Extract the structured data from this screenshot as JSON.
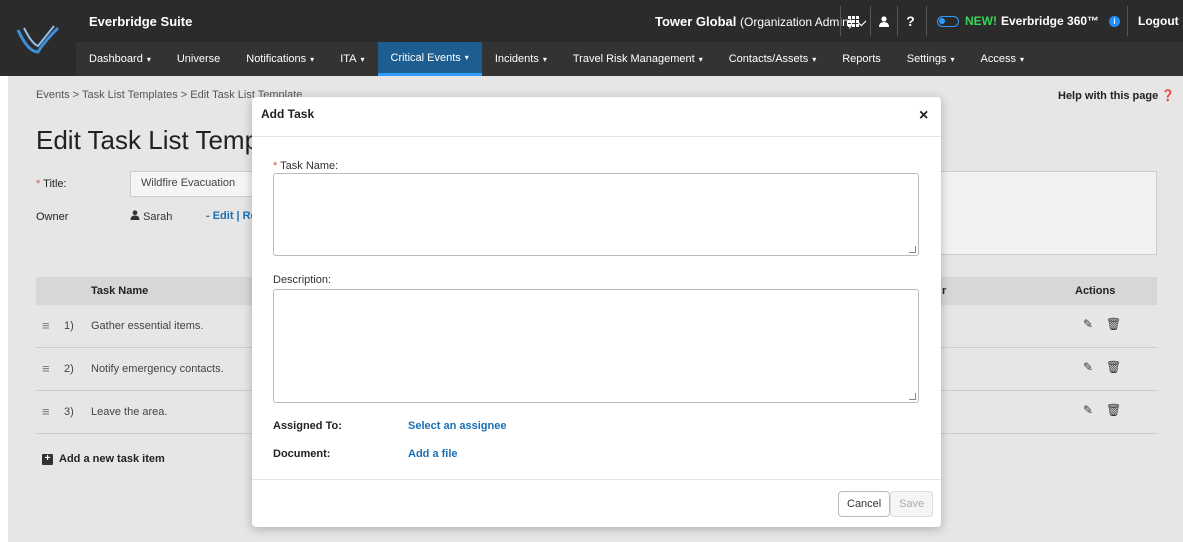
{
  "header": {
    "suite_title": "Everbridge Suite",
    "org_name": "Tower Global",
    "org_role": "(Organization Admin)",
    "new_label": "NEW!",
    "e360_label": "Everbridge 360™",
    "help_icon_text": "?",
    "logout": "Logout"
  },
  "nav": {
    "items": [
      {
        "label": "Dashboard",
        "chev": "▾"
      },
      {
        "label": "Universe",
        "chev": ""
      },
      {
        "label": "Notifications",
        "chev": "▾"
      },
      {
        "label": "ITA",
        "chev": "▾"
      },
      {
        "label": "Critical Events",
        "chev": "▾",
        "active": true
      },
      {
        "label": "Incidents",
        "chev": "▾"
      },
      {
        "label": "Travel Risk Management",
        "chev": "▾"
      },
      {
        "label": "Contacts/Assets",
        "chev": "▾"
      },
      {
        "label": "Reports",
        "chev": ""
      },
      {
        "label": "Settings",
        "chev": "▾"
      },
      {
        "label": "Access",
        "chev": "▾"
      }
    ]
  },
  "breadcrumb": "Events  >  Task List Templates  >  Edit Task List Template",
  "help_page": "Help with this page",
  "page_title": "Edit Task List Temp",
  "form": {
    "title_label": "Title:",
    "title_value": "Wildfire Evacuation",
    "owner_label": "Owner",
    "owner_value": "Sarah",
    "owner_links": "- Edit  |  Re"
  },
  "table": {
    "col_task_name": "Task Name",
    "col_partial": "r",
    "col_actions": "Actions",
    "rows": [
      {
        "num": "1)",
        "name": "Gather essential items."
      },
      {
        "num": "2)",
        "name": "Notify emergency contacts."
      },
      {
        "num": "3)",
        "name": "Leave the area."
      }
    ],
    "add_item": "Add a new task item"
  },
  "modal": {
    "title": "Add Task",
    "close": "×",
    "task_name_label": "Task Name:",
    "task_name_value": "",
    "description_label": "Description:",
    "description_value": "",
    "assigned_to_label": "Assigned To:",
    "assigned_to_link": "Select an assignee",
    "document_label": "Document:",
    "document_link": "Add a file",
    "cancel": "Cancel",
    "save": "Save"
  }
}
